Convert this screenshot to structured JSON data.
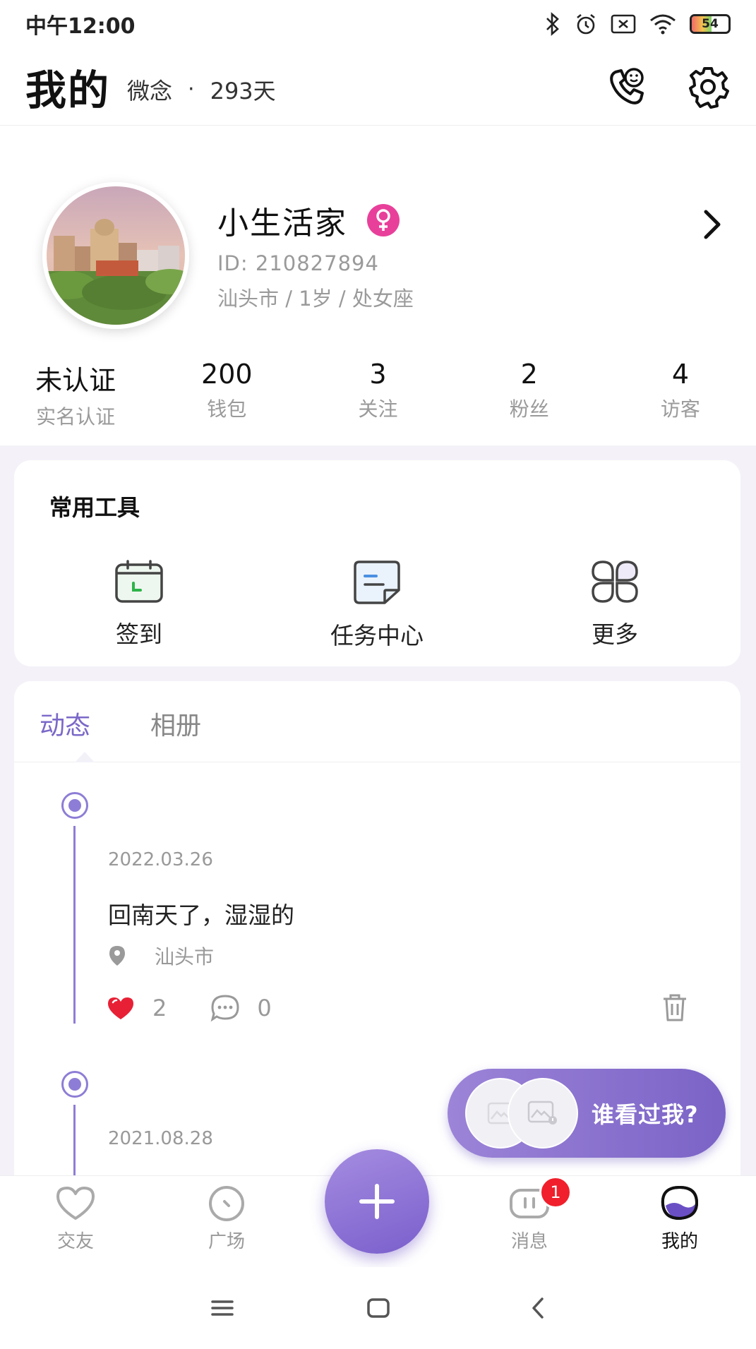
{
  "status_bar": {
    "time": "中午12:00",
    "battery": "54"
  },
  "header": {
    "title": "我的",
    "app_name": "微念",
    "separator": "·",
    "days": "293天"
  },
  "profile": {
    "name": "小生活家",
    "gender": "female",
    "id": "ID: 210827894",
    "meta": "汕头市 / 1岁 / 处女座"
  },
  "stats": [
    {
      "value": "未认证",
      "label": "实名认证"
    },
    {
      "value": "200",
      "label": "钱包"
    },
    {
      "value": "3",
      "label": "关注"
    },
    {
      "value": "2",
      "label": "粉丝"
    },
    {
      "value": "4",
      "label": "访客"
    }
  ],
  "tools": {
    "title": "常用工具",
    "items": [
      {
        "label": "签到",
        "icon": "calendar-icon"
      },
      {
        "label": "任务中心",
        "icon": "task-note-icon"
      },
      {
        "label": "更多",
        "icon": "more-grid-icon"
      }
    ]
  },
  "feed": {
    "tabs": [
      {
        "label": "动态"
      },
      {
        "label": "相册"
      }
    ],
    "posts": [
      {
        "date": "2022.03.26",
        "text": "回南天了，湿湿的",
        "location": "汕头市",
        "likes": "2",
        "comments": "0"
      },
      {
        "date": "2021.08.28"
      }
    ]
  },
  "viewed_me": {
    "label": "谁看过我?"
  },
  "tabbar": {
    "items": [
      {
        "label": "交友"
      },
      {
        "label": "广场"
      },
      {
        "label": "消息"
      },
      {
        "label": "我的"
      }
    ],
    "message_badge": "1"
  },
  "colors": {
    "accent": "#7b68c8",
    "gender_female": "#e8409a",
    "like_red": "#e82035"
  }
}
